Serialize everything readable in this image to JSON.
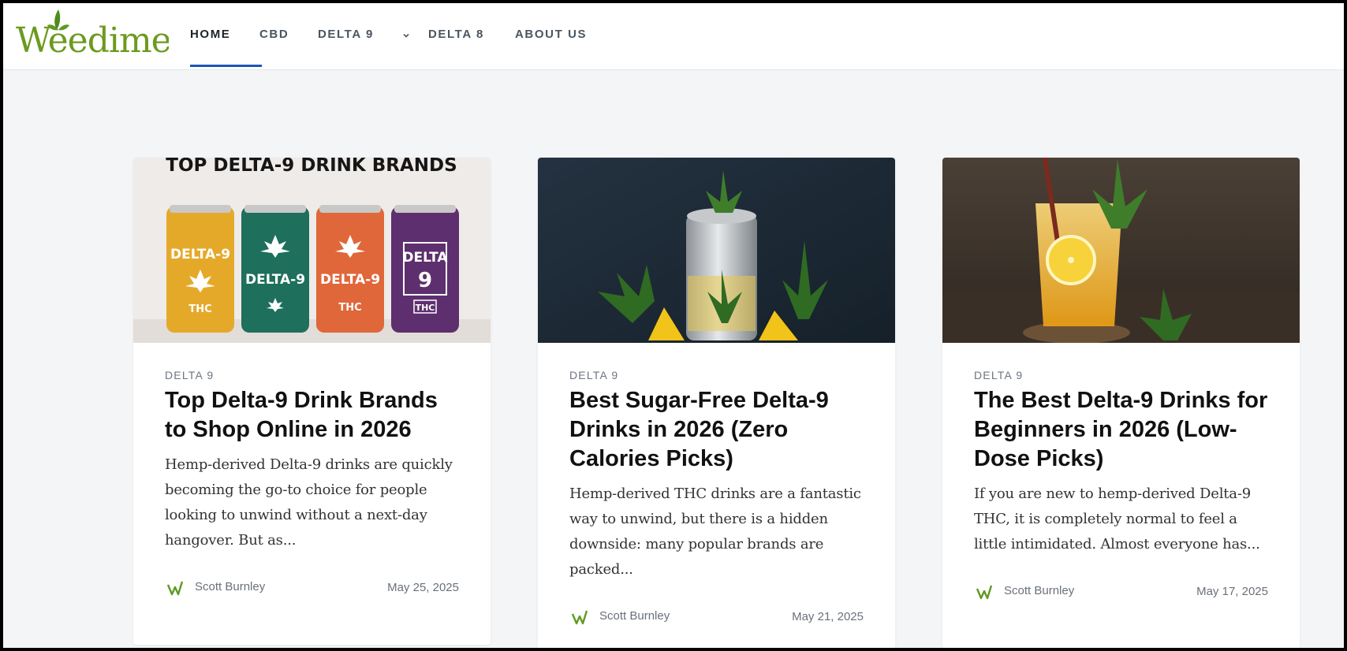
{
  "site": {
    "logo_text": "Weedime"
  },
  "nav": {
    "items": [
      {
        "label": "HOME"
      },
      {
        "label": "CBD"
      },
      {
        "label": "DELTA 9"
      },
      {
        "label": "DELTA 8"
      },
      {
        "label": "ABOUT US"
      }
    ]
  },
  "cards": [
    {
      "image_text": "TOP DELTA-9 DRINK BRANDS",
      "category": "DELTA 9",
      "title": "Top Delta-9 Drink Brands to Shop Online in 2026",
      "excerpt": "Hemp-derived Delta-9 drinks are quickly becoming the go-to choice for people looking to unwind without a next-day hangover. But as...",
      "author": "Scott Burnley",
      "date": "May 25, 2025"
    },
    {
      "category": "DELTA 9",
      "title": "Best Sugar-Free Delta-9 Drinks in 2026 (Zero Calories Picks)",
      "excerpt": "Hemp-derived THC drinks are a fantastic way to unwind, but there is a hidden downside: many popular brands are packed...",
      "author": "Scott Burnley",
      "date": "May 21, 2025"
    },
    {
      "category": "DELTA 9",
      "title": "The Best Delta-9 Drinks for Beginners in 2026 (Low-Dose Picks)",
      "excerpt": "If you are new to hemp-derived Delta-9 THC, it is completely normal to feel a little intimidated. Almost everyone has...",
      "author": "Scott Burnley",
      "date": "May 17, 2025"
    }
  ],
  "can_labels": {
    "can1": [
      "DELTA-9",
      "THC"
    ],
    "can2": [
      "DELTA-9"
    ],
    "can3": [
      "DELTA-9",
      "THC"
    ],
    "can4": [
      "DELTA",
      "9",
      "THC"
    ]
  },
  "colors": {
    "accent_underline": "#1a57b5",
    "logo_green": "#6c9a1f",
    "can_yellow": "#e5a92a",
    "can_teal": "#1e6f5c",
    "can_orange": "#e0673a",
    "can_purple": "#5e2f6e"
  }
}
